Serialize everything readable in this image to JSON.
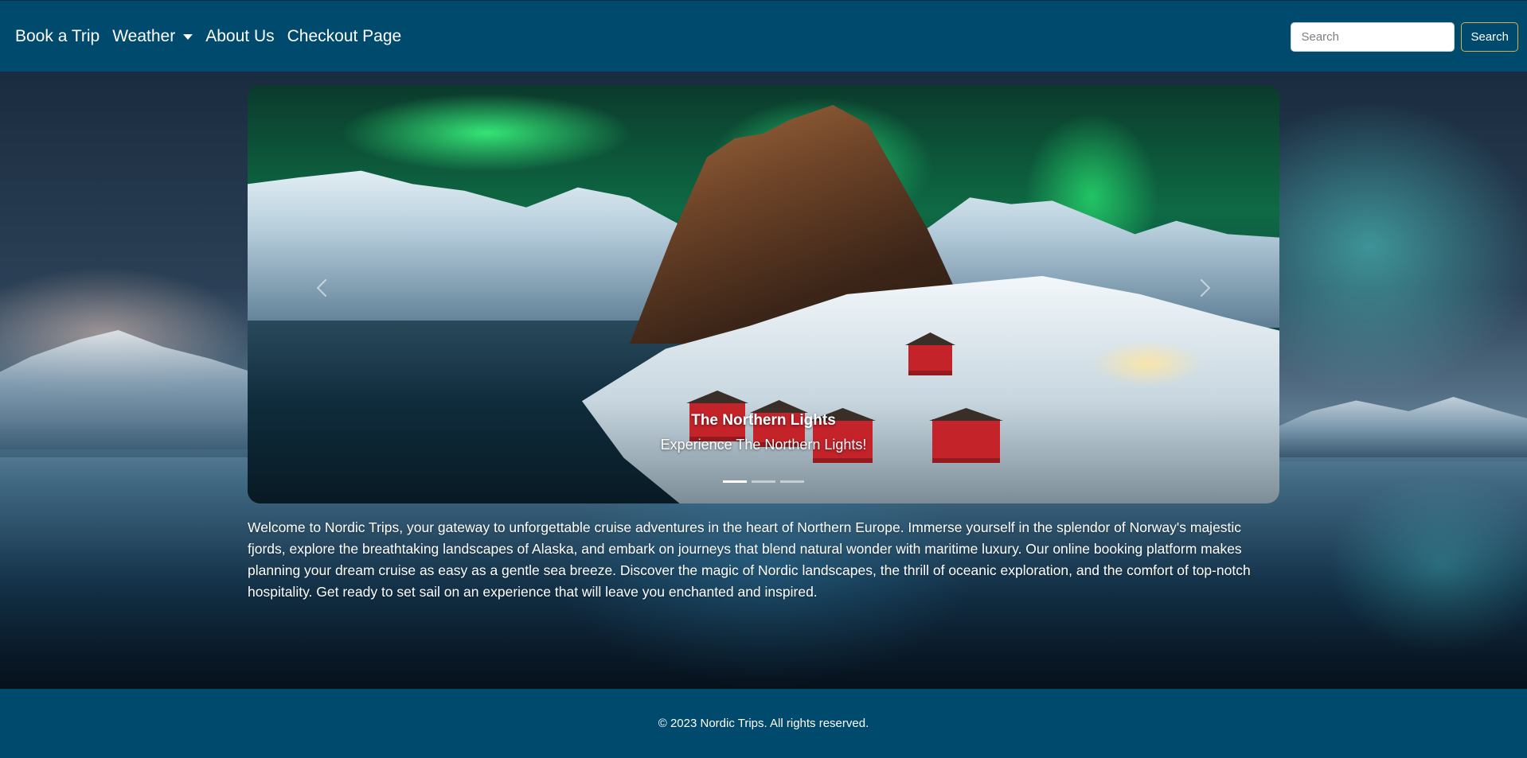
{
  "navbar": {
    "links": [
      {
        "label": "Book a Trip"
      },
      {
        "label": "Weather",
        "has_dropdown": true
      },
      {
        "label": "About Us"
      },
      {
        "label": "Checkout Page"
      }
    ],
    "search": {
      "placeholder": "Search",
      "value": "",
      "button_label": "Search"
    }
  },
  "carousel": {
    "active_index": 0,
    "slide_count": 3,
    "caption_title": "The Northern Lights",
    "caption_text": "Experience The Northern Lights!",
    "prev_icon": "chevron-left-icon",
    "next_icon": "chevron-right-icon"
  },
  "intro": {
    "text": "Welcome to Nordic Trips, your gateway to unforgettable cruise adventures in the heart of Northern Europe. Immerse yourself in the splendor of Norway's majestic fjords, explore the breathtaking landscapes of Alaska, and embark on journeys that blend natural wonder with maritime luxury. Our online booking platform makes planning your dream cruise as easy as a gentle sea breeze. Discover the magic of Nordic landscapes, the thrill of oceanic exploration, and the comfort of top-notch hospitality. Get ready to set sail on an experience that will leave you enchanted and inspired."
  },
  "footer": {
    "text": "© 2023 Nordic Trips. All rights reserved."
  },
  "colors": {
    "navbar_bg": "#004a6e",
    "footer_bg": "#004a6e",
    "search_button_border": "#d4b24a",
    "text": "#ffffff"
  }
}
